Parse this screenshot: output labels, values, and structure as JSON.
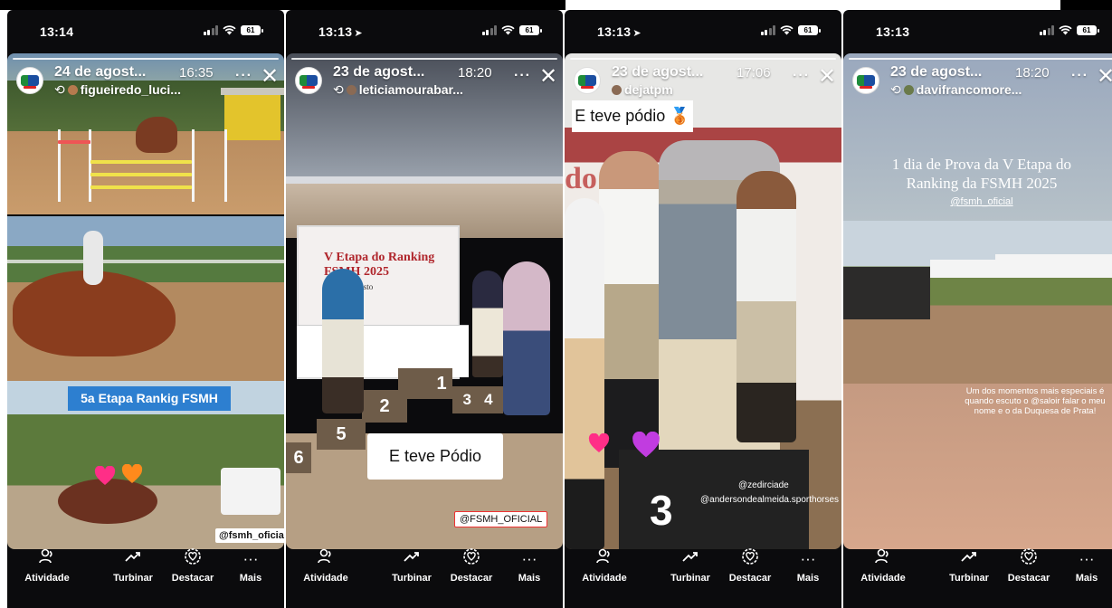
{
  "nav_labels": {
    "atividade": "Atividade",
    "turbinar": "Turbinar",
    "destacar": "Destacar",
    "mais": "Mais"
  },
  "stories": [
    {
      "status_time": "13:14",
      "date": "24 de agost...",
      "time": "16:35",
      "user": "figueiredo_luci...",
      "overlay_label": "5a Etapa Rankig FSMH",
      "tag": "@fsmh_oficial"
    },
    {
      "status_time": "13:13",
      "date": "23 de agost...",
      "time": "18:20",
      "user": "leticiamourabar...",
      "banner_line1": "V Etapa do Ranking",
      "banner_line2": "FSMH 2025",
      "banner_line3": "23 e 24 Agosto",
      "podium_numbers": [
        "1",
        "2",
        "3",
        "4",
        "5",
        "6"
      ],
      "caption": "E teve Pódio",
      "tag": "@FSMH_OFICIAL"
    },
    {
      "status_time": "13:13",
      "date": "23 de agost...",
      "time": "17:06",
      "user": "dejatpm",
      "caption": "E teve pódio",
      "podium_number": "3",
      "tag_1": "@zedirciade",
      "tag_2": "@andersondealmeida.sporthorses"
    },
    {
      "status_time": "13:13",
      "date": "23 de agost...",
      "time": "18:20",
      "user": "davifrancomore...",
      "caption": "1 dia de Prova da V Etapa do Ranking da FSMH 2025",
      "caption_mention": "@fsmh_oficial",
      "small_caption": "Um dos momentos mais especiais é quando escuto o @saloir falar o meu nome e o da Duquesa de Prata!"
    }
  ]
}
